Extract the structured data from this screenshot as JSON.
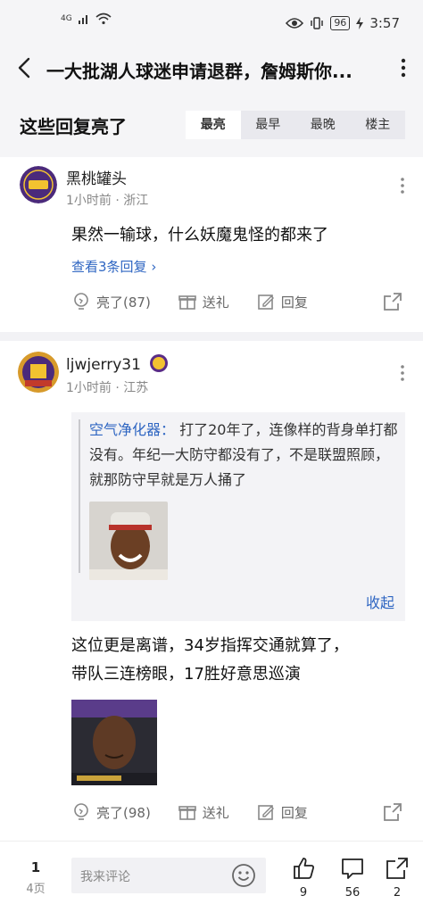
{
  "status_bar": {
    "network": "4G",
    "battery": "96",
    "time": "3:57",
    "icons": [
      "signal-icon",
      "wifi-icon",
      "eye-icon",
      "vibrate-icon",
      "battery-icon",
      "charging-icon"
    ]
  },
  "header": {
    "title": "一大批湖人球迷申请退群，詹姆斯你..."
  },
  "replies_section": {
    "title": "这些回复亮了",
    "tabs": [
      "最亮",
      "最早",
      "最晚",
      "楼主"
    ],
    "active_tab": "最亮"
  },
  "comments": [
    {
      "username": "黑桃罐头",
      "meta": "1小时前 · 浙江",
      "text": "果然一输球，什么妖魔鬼怪的都来了",
      "view_replies": "查看3条回复",
      "actions": {
        "like": "亮了(87)",
        "gift": "送礼",
        "reply": "回复"
      }
    },
    {
      "username": "ljwjerry31",
      "meta": "1小时前 · 江苏",
      "quote": {
        "author": "空气净化器：",
        "text": "打了20年了，连像样的背身单打都没有。年纪一大防守都没有了，不是联盟照顾，就那防守早就是万人捅了",
        "collapse": "收起"
      },
      "text_lines": [
        "这位更是离谱，34岁指挥交通就算了，",
        "带队三连榜眼，17胜好意思巡演"
      ],
      "actions": {
        "like": "亮了(98)",
        "gift": "送礼",
        "reply": "回复"
      }
    }
  ],
  "bottom_bar": {
    "page": "1",
    "total_pages": "4页",
    "input_placeholder": "我来评论",
    "like_count": "9",
    "comment_count": "56",
    "share_count": "2"
  },
  "colors": {
    "link": "#2f66c2",
    "header_bg": "#f5f5f7",
    "text": "#222222",
    "muted": "#888888"
  }
}
